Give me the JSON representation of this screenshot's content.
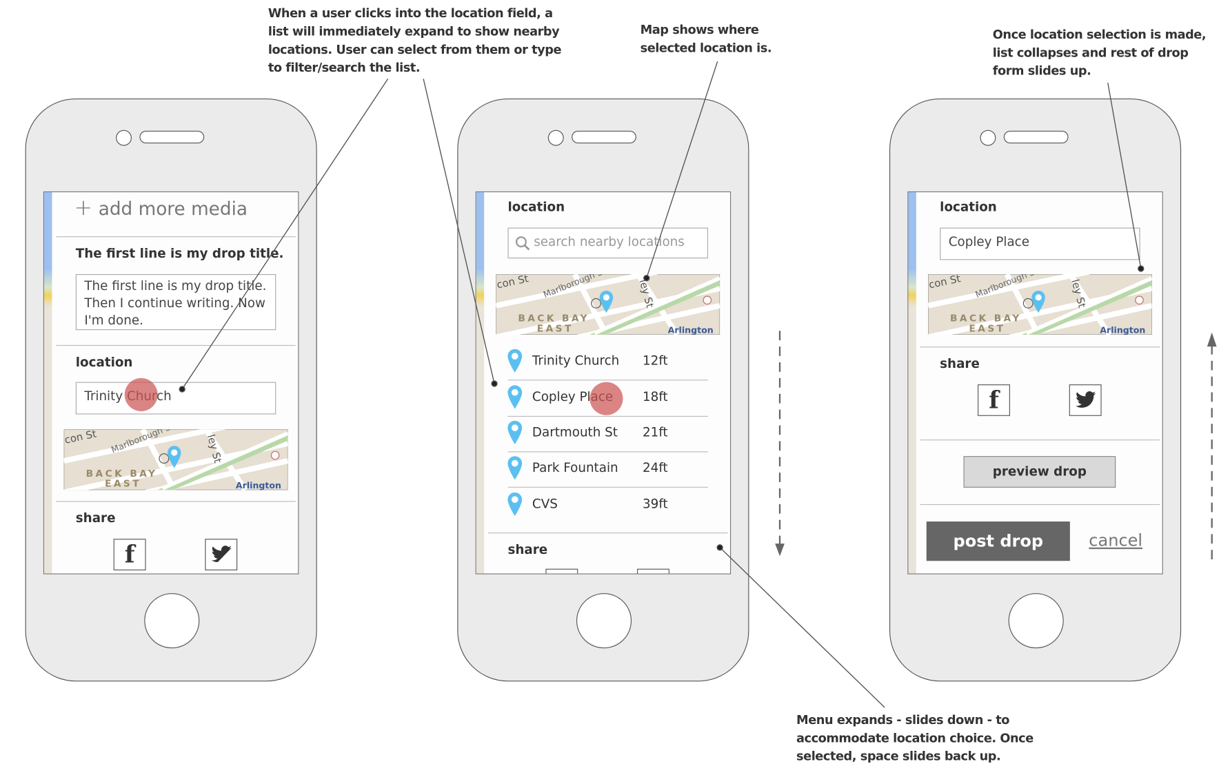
{
  "annotations": {
    "location_field": "When a user clicks into the location field, a\nlist will immediately expand to show nearby\nlocations. User can select from them or type\nto filter/search the list.",
    "map": "Map shows where\nselected location is.",
    "collapse": "Once location selection is made,\nlist collapses and rest of drop\nform slides up.",
    "expand": "Menu expands - slides down - to\naccommodate location choice. Once\nselected, space slides back up."
  },
  "map_labels": {
    "street1": "con St",
    "street2": "Marlborough St",
    "street3": "ley St",
    "district1": "BACK BAY",
    "district2": "EAST",
    "place": "Arlington"
  },
  "screen1": {
    "add_media": "add more media",
    "title": "The first line is my drop title.",
    "body": "The first line is my drop title.\nThen I continue writing. Now\nI'm done.",
    "location_label": "location",
    "location_value": "Trinity Church",
    "share_label": "share"
  },
  "screen2": {
    "location_label": "location",
    "search_placeholder": "search nearby locations",
    "locations": [
      {
        "name": "Trinity Church",
        "distance": "12ft"
      },
      {
        "name": "Copley Place",
        "distance": "18ft"
      },
      {
        "name": "Dartmouth St",
        "distance": "21ft"
      },
      {
        "name": "Park Fountain",
        "distance": "24ft"
      },
      {
        "name": "CVS",
        "distance": "39ft"
      }
    ],
    "share_label": "share"
  },
  "screen3": {
    "location_label": "location",
    "location_value": "Copley Place",
    "share_label": "share",
    "preview_button": "preview drop",
    "post_button": "post drop",
    "cancel_link": "cancel"
  },
  "colors": {
    "pin": "#5bc0f0",
    "tap_indicator": "#cd5555",
    "post_button": "#666666",
    "phone_body": "#ebebeb"
  },
  "icons": [
    "plus-icon",
    "search-icon",
    "map-pin-icon",
    "facebook-icon",
    "twitter-icon"
  ]
}
